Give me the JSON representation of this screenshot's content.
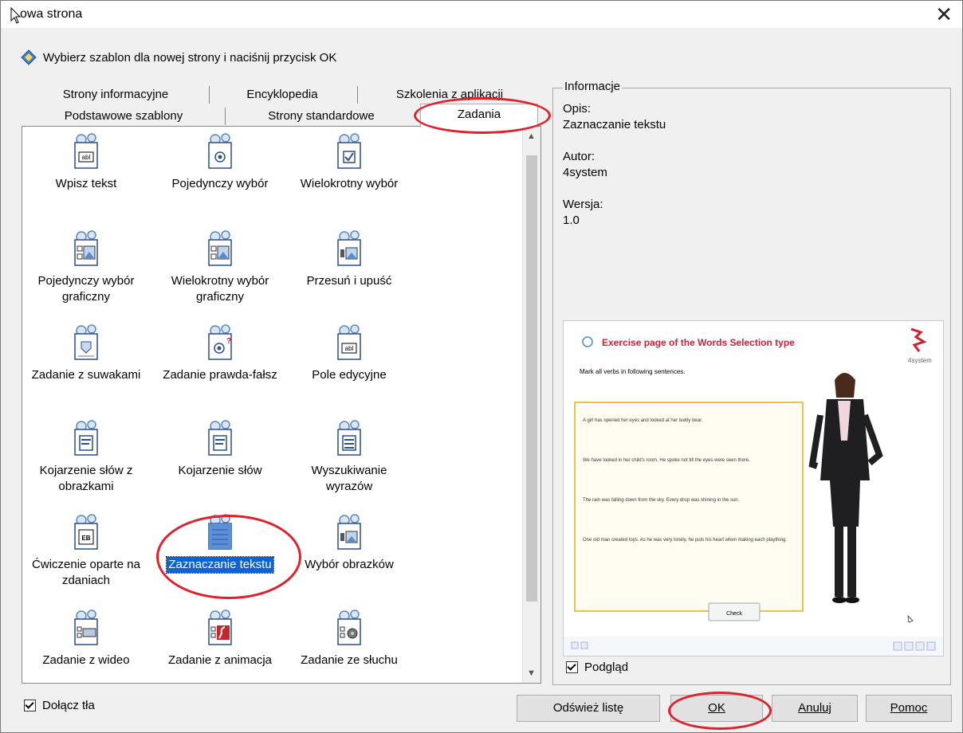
{
  "window": {
    "title": "owa strona",
    "close_glyph": "✕"
  },
  "prompt": {
    "icon": "diamond-info-icon",
    "text": "Wybierz szablon dla nowej strony i naciśnij przycisk OK"
  },
  "tabs": {
    "row1": [
      "Strony informacyjne",
      "Encyklopedia",
      "Szkolenia z aplikacji"
    ],
    "row2": [
      "Podstawowe szablony",
      "Strony standardowe",
      "Zadania"
    ],
    "active": "Zadania"
  },
  "templates": [
    {
      "label": "Wpisz tekst",
      "icon": "text-field-icon"
    },
    {
      "label": "Pojedynczy wybór",
      "icon": "radio-button-icon"
    },
    {
      "label": "Wielokrotny wybór",
      "icon": "checkbox-icon"
    },
    {
      "label": "Pojedynczy wybór graficzny",
      "icon": "image-radio-icon"
    },
    {
      "label": "Wielokrotny wybór graficzny",
      "icon": "image-checkbox-icon"
    },
    {
      "label": "Przesuń i upuść",
      "icon": "drag-drop-icon"
    },
    {
      "label": "Zadanie z suwakami",
      "icon": "slider-icon"
    },
    {
      "label": "Zadanie prawda-fałsz",
      "icon": "true-false-icon"
    },
    {
      "label": "Pole edycyjne",
      "icon": "edit-field-icon"
    },
    {
      "label": "Kojarzenie słów z obrazkami",
      "icon": "word-image-match-icon"
    },
    {
      "label": "Kojarzenie słów",
      "icon": "word-match-icon"
    },
    {
      "label": "Wyszukiwanie wyrazów",
      "icon": "word-search-icon"
    },
    {
      "label": "Ćwiczenie oparte na zdaniach",
      "icon": "sentence-exercise-icon"
    },
    {
      "label": "Zaznaczanie tekstu",
      "icon": "text-selection-icon",
      "selected": true
    },
    {
      "label": "Wybór obrazków",
      "icon": "image-choice-icon"
    },
    {
      "label": "Zadanie z wideo",
      "icon": "video-icon"
    },
    {
      "label": "Zadanie z animacja",
      "icon": "flash-animation-icon"
    },
    {
      "label": "Zadanie ze słuchu",
      "icon": "audio-icon"
    }
  ],
  "info": {
    "legend": "Informacje",
    "opis_label": "Opis:",
    "opis_value": "Zaznaczanie tekstu",
    "autor_label": "Autor:",
    "autor_value": "4system",
    "wersja_label": "Wersja:",
    "wersja_value": "1.0"
  },
  "preview": {
    "title": "Exercise page of the Words Selection type",
    "brand": "4system",
    "instruction": "Mark all verbs in following sentences.",
    "sentences": [
      "A girl has opened her eyes and looked at her teddy bear.",
      "We have looked in her child's room. He spoke not till the eyes were seen there.",
      "The rain was falling down from the sky. Every drop was shining in the sun.",
      "One old man created toys. As he was very lonely, he puts his heart when making each plaything."
    ],
    "check_button": "Check"
  },
  "checkboxes": {
    "podglad": "Podgląd",
    "dolacz": "Dołącz tła"
  },
  "buttons": {
    "refresh": "Odśwież listę",
    "ok": "OK",
    "cancel": "Anuluj",
    "help": "Pomoc"
  },
  "colors": {
    "selection": "#0a64d8",
    "annotation": "#e0202a",
    "preview_title": "#c4243a"
  }
}
